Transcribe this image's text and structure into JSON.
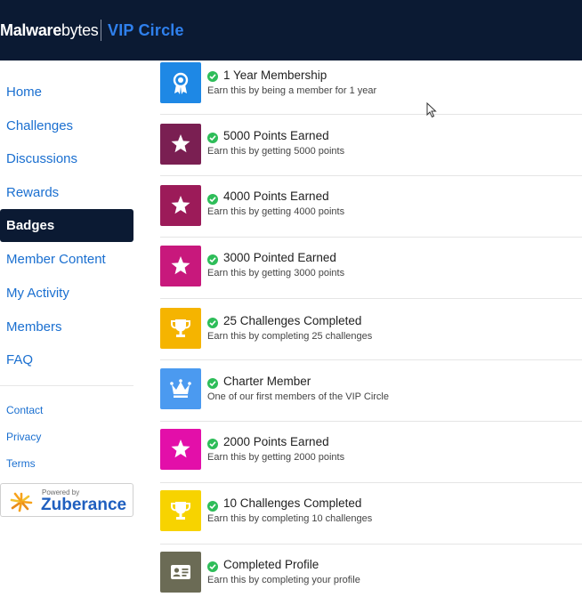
{
  "header": {
    "brand_first": "M",
    "brand_rest": "alware",
    "brand_bytes": "bytes",
    "program": "VIP Circle",
    "bg_color": "#0b1a33",
    "accent_color": "#2f80ed"
  },
  "sidebar": {
    "items": [
      {
        "label": "Home",
        "active": false
      },
      {
        "label": "Challenges",
        "active": false
      },
      {
        "label": "Discussions",
        "active": false
      },
      {
        "label": "Rewards",
        "active": false
      },
      {
        "label": "Badges",
        "active": true
      },
      {
        "label": "Member Content",
        "active": false
      },
      {
        "label": "My Activity",
        "active": false
      },
      {
        "label": "Members",
        "active": false
      },
      {
        "label": "FAQ",
        "active": false
      }
    ],
    "footer_links": [
      "Contact",
      "Privacy",
      "Terms"
    ],
    "powered_by": {
      "caption": "Powered by",
      "name": "Zuberance"
    }
  },
  "badges": [
    {
      "title": "1 Year Membership",
      "description": "Earn this by being a member for 1 year",
      "icon": "ribbon-icon",
      "color": "#1e88e5",
      "earned": true
    },
    {
      "title": "5000 Points Earned",
      "description": "Earn this by getting 5000 points",
      "icon": "star-icon",
      "color": "#7a1f52",
      "earned": true
    },
    {
      "title": "4000 Points Earned",
      "description": "Earn this by getting 4000 points",
      "icon": "star-icon",
      "color": "#9c1b59",
      "earned": true
    },
    {
      "title": "3000 Pointed Earned",
      "description": "Earn this by getting 3000 points",
      "icon": "star-icon",
      "color": "#c8187c",
      "earned": true
    },
    {
      "title": "25 Challenges Completed",
      "description": "Earn this by completing 25 challenges",
      "icon": "trophy-icon",
      "color": "#f5b400",
      "earned": true
    },
    {
      "title": "Charter Member",
      "description": "One of our first members of the VIP Circle",
      "icon": "crown-icon",
      "color": "#4b9af0",
      "earned": true
    },
    {
      "title": "2000 Points Earned",
      "description": "Earn this by getting 2000 points",
      "icon": "star-icon",
      "color": "#e30fa9",
      "earned": true
    },
    {
      "title": "10 Challenges Completed",
      "description": "Earn this by completing 10 challenges",
      "icon": "trophy-icon",
      "color": "#f7d300",
      "earned": true
    },
    {
      "title": "Completed Profile",
      "description": "Earn this by completing your profile",
      "icon": "id-card-icon",
      "color": "#6b6b55",
      "earned": true
    }
  ]
}
